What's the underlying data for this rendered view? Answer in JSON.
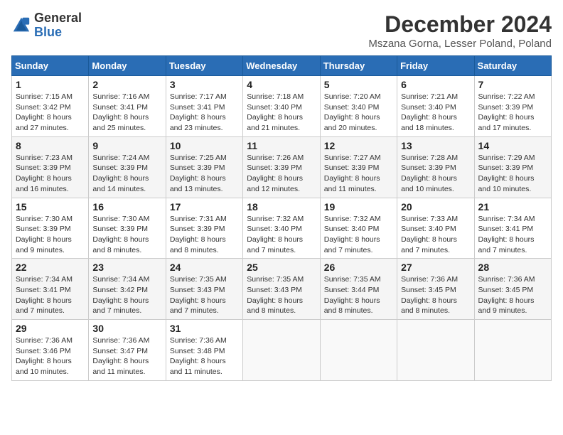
{
  "header": {
    "logo_line1": "General",
    "logo_line2": "Blue",
    "month_title": "December 2024",
    "subtitle": "Mszana Gorna, Lesser Poland, Poland"
  },
  "days_of_week": [
    "Sunday",
    "Monday",
    "Tuesday",
    "Wednesday",
    "Thursday",
    "Friday",
    "Saturday"
  ],
  "weeks": [
    [
      {
        "day": "1",
        "sunrise": "7:15 AM",
        "sunset": "3:42 PM",
        "daylight": "8 hours and 27 minutes."
      },
      {
        "day": "2",
        "sunrise": "7:16 AM",
        "sunset": "3:41 PM",
        "daylight": "8 hours and 25 minutes."
      },
      {
        "day": "3",
        "sunrise": "7:17 AM",
        "sunset": "3:41 PM",
        "daylight": "8 hours and 23 minutes."
      },
      {
        "day": "4",
        "sunrise": "7:18 AM",
        "sunset": "3:40 PM",
        "daylight": "8 hours and 21 minutes."
      },
      {
        "day": "5",
        "sunrise": "7:20 AM",
        "sunset": "3:40 PM",
        "daylight": "8 hours and 20 minutes."
      },
      {
        "day": "6",
        "sunrise": "7:21 AM",
        "sunset": "3:40 PM",
        "daylight": "8 hours and 18 minutes."
      },
      {
        "day": "7",
        "sunrise": "7:22 AM",
        "sunset": "3:39 PM",
        "daylight": "8 hours and 17 minutes."
      }
    ],
    [
      {
        "day": "8",
        "sunrise": "7:23 AM",
        "sunset": "3:39 PM",
        "daylight": "8 hours and 16 minutes."
      },
      {
        "day": "9",
        "sunrise": "7:24 AM",
        "sunset": "3:39 PM",
        "daylight": "8 hours and 14 minutes."
      },
      {
        "day": "10",
        "sunrise": "7:25 AM",
        "sunset": "3:39 PM",
        "daylight": "8 hours and 13 minutes."
      },
      {
        "day": "11",
        "sunrise": "7:26 AM",
        "sunset": "3:39 PM",
        "daylight": "8 hours and 12 minutes."
      },
      {
        "day": "12",
        "sunrise": "7:27 AM",
        "sunset": "3:39 PM",
        "daylight": "8 hours and 11 minutes."
      },
      {
        "day": "13",
        "sunrise": "7:28 AM",
        "sunset": "3:39 PM",
        "daylight": "8 hours and 10 minutes."
      },
      {
        "day": "14",
        "sunrise": "7:29 AM",
        "sunset": "3:39 PM",
        "daylight": "8 hours and 10 minutes."
      }
    ],
    [
      {
        "day": "15",
        "sunrise": "7:30 AM",
        "sunset": "3:39 PM",
        "daylight": "8 hours and 9 minutes."
      },
      {
        "day": "16",
        "sunrise": "7:30 AM",
        "sunset": "3:39 PM",
        "daylight": "8 hours and 8 minutes."
      },
      {
        "day": "17",
        "sunrise": "7:31 AM",
        "sunset": "3:39 PM",
        "daylight": "8 hours and 8 minutes."
      },
      {
        "day": "18",
        "sunrise": "7:32 AM",
        "sunset": "3:40 PM",
        "daylight": "8 hours and 7 minutes."
      },
      {
        "day": "19",
        "sunrise": "7:32 AM",
        "sunset": "3:40 PM",
        "daylight": "8 hours and 7 minutes."
      },
      {
        "day": "20",
        "sunrise": "7:33 AM",
        "sunset": "3:40 PM",
        "daylight": "8 hours and 7 minutes."
      },
      {
        "day": "21",
        "sunrise": "7:34 AM",
        "sunset": "3:41 PM",
        "daylight": "8 hours and 7 minutes."
      }
    ],
    [
      {
        "day": "22",
        "sunrise": "7:34 AM",
        "sunset": "3:41 PM",
        "daylight": "8 hours and 7 minutes."
      },
      {
        "day": "23",
        "sunrise": "7:34 AM",
        "sunset": "3:42 PM",
        "daylight": "8 hours and 7 minutes."
      },
      {
        "day": "24",
        "sunrise": "7:35 AM",
        "sunset": "3:43 PM",
        "daylight": "8 hours and 7 minutes."
      },
      {
        "day": "25",
        "sunrise": "7:35 AM",
        "sunset": "3:43 PM",
        "daylight": "8 hours and 8 minutes."
      },
      {
        "day": "26",
        "sunrise": "7:35 AM",
        "sunset": "3:44 PM",
        "daylight": "8 hours and 8 minutes."
      },
      {
        "day": "27",
        "sunrise": "7:36 AM",
        "sunset": "3:45 PM",
        "daylight": "8 hours and 8 minutes."
      },
      {
        "day": "28",
        "sunrise": "7:36 AM",
        "sunset": "3:45 PM",
        "daylight": "8 hours and 9 minutes."
      }
    ],
    [
      {
        "day": "29",
        "sunrise": "7:36 AM",
        "sunset": "3:46 PM",
        "daylight": "8 hours and 10 minutes."
      },
      {
        "day": "30",
        "sunrise": "7:36 AM",
        "sunset": "3:47 PM",
        "daylight": "8 hours and 11 minutes."
      },
      {
        "day": "31",
        "sunrise": "7:36 AM",
        "sunset": "3:48 PM",
        "daylight": "8 hours and 11 minutes."
      },
      null,
      null,
      null,
      null
    ]
  ]
}
